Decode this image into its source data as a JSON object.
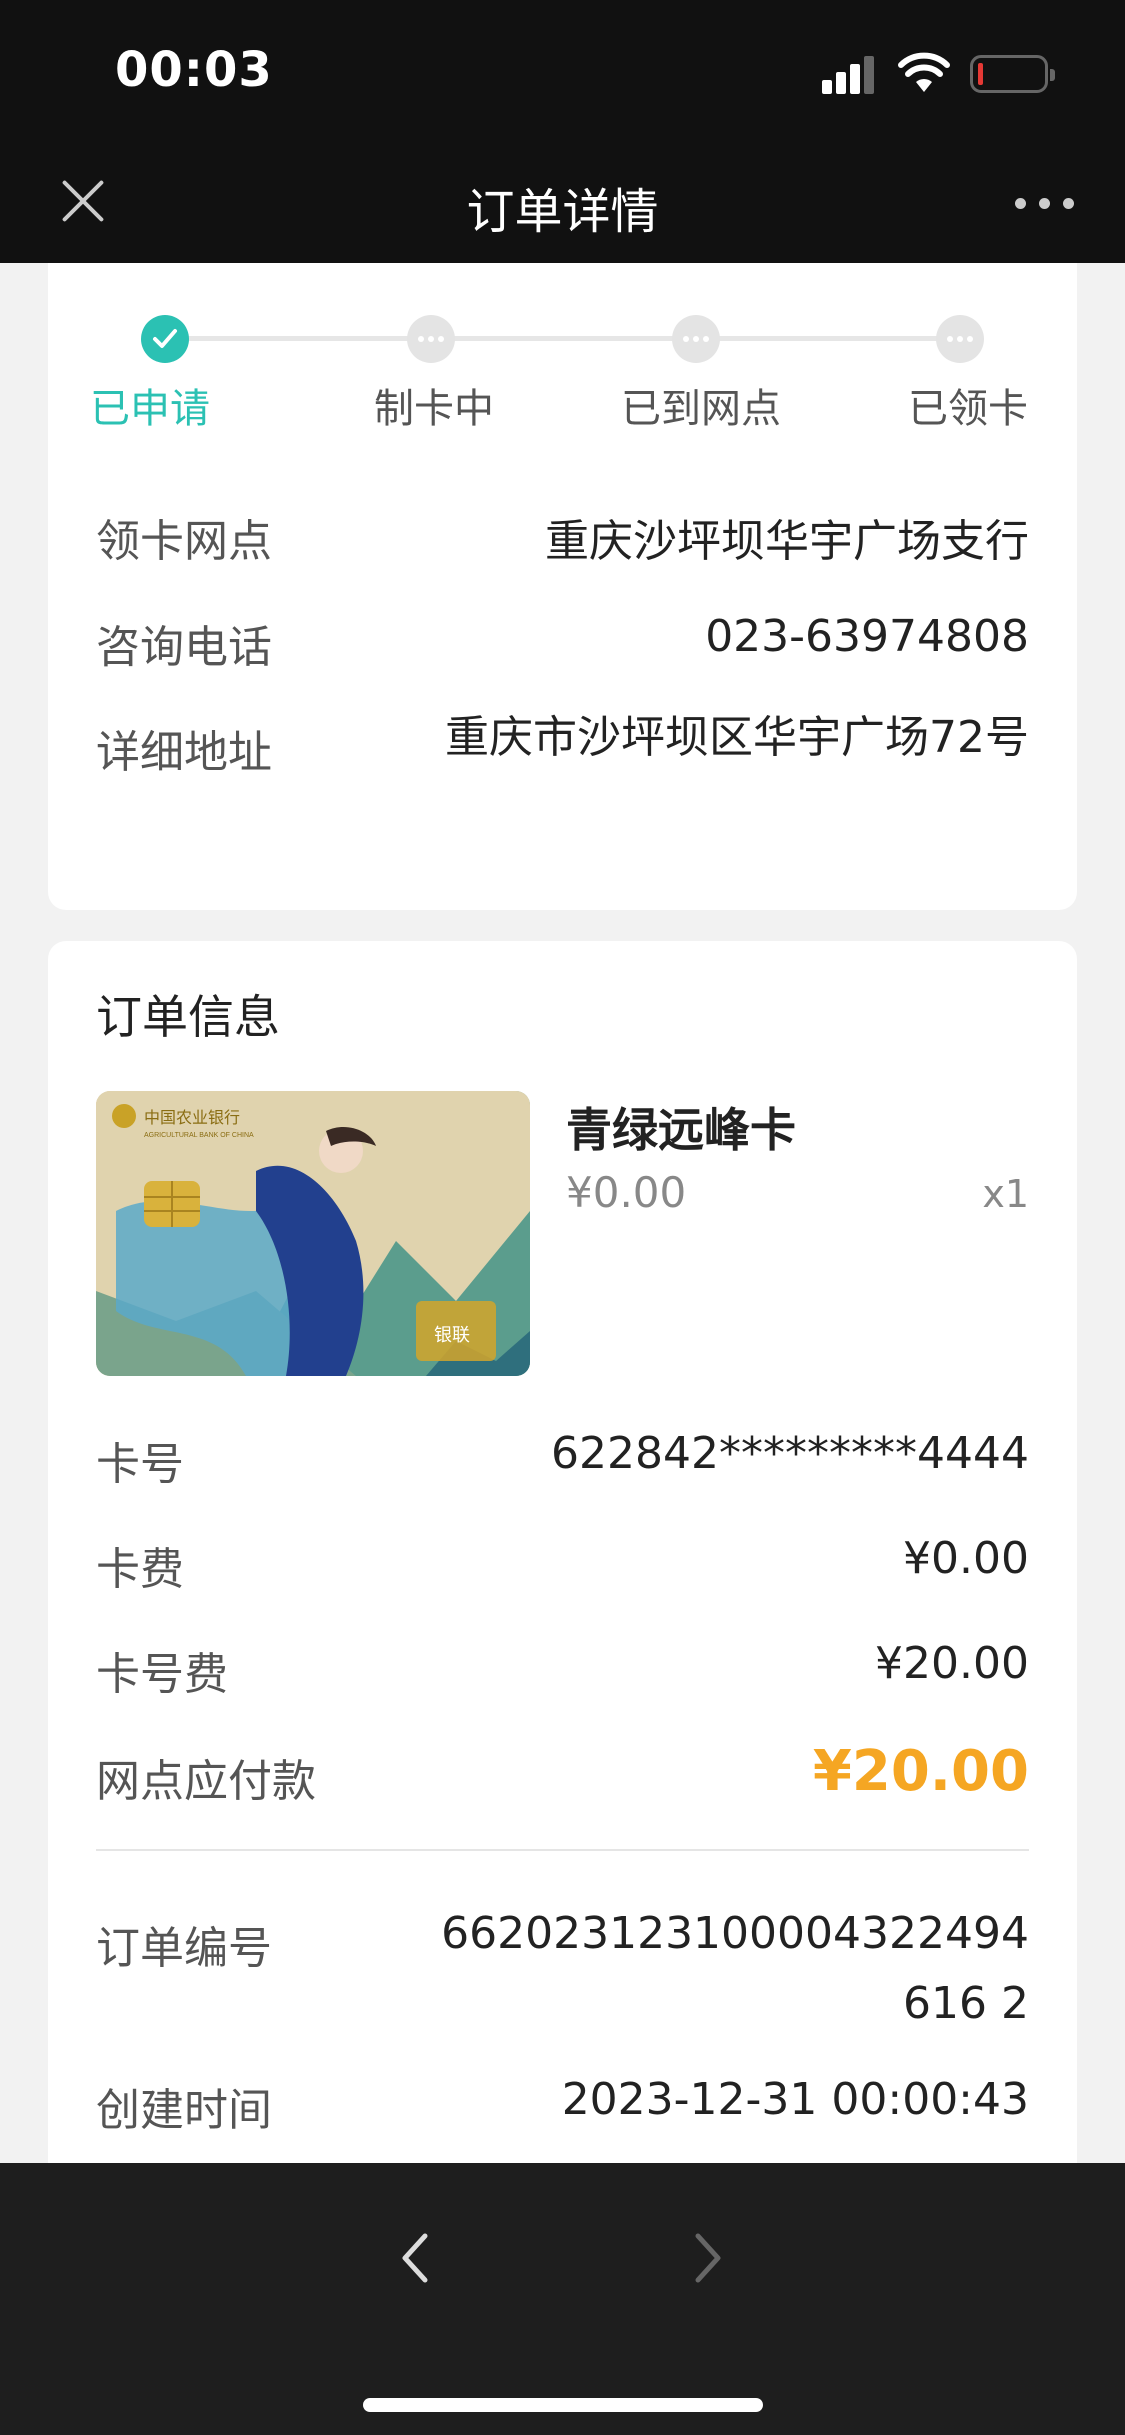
{
  "status_bar": {
    "time": "00:03"
  },
  "nav": {
    "title": "订单详情"
  },
  "steps": [
    {
      "label": "已申请",
      "state": "done"
    },
    {
      "label": "制卡中",
      "state": "pending"
    },
    {
      "label": "已到网点",
      "state": "pending"
    },
    {
      "label": "已领卡",
      "state": "pending"
    }
  ],
  "branch": {
    "branch_label": "领卡网点",
    "branch_value": "重庆沙坪坝华宇广场支行",
    "phone_label": "咨询电话",
    "phone_value": "023-63974808",
    "address_label": "详细地址",
    "address_value": "重庆市沙坪坝区华宇广场72号"
  },
  "order": {
    "section_title": "订单信息",
    "product": {
      "name": "青绿远峰卡",
      "price": "¥0.00",
      "qty": "x1",
      "image_bank_name": "中国农业银行",
      "image_bank_name_en": "AGRICULTURAL BANK OF CHINA",
      "image_network": "银联"
    },
    "card_no_label": "卡号",
    "card_no_value": "622842*********4444",
    "card_fee_label": "卡费",
    "card_fee_value": "¥0.00",
    "number_fee_label": "卡号费",
    "number_fee_value": "¥20.00",
    "pay_label": "网点应付款",
    "pay_value": "¥20.00",
    "order_no_label": "订单编号",
    "order_no_value": "662023123100004322494616 2",
    "created_label": "创建时间",
    "created_value": "2023-12-31 00:00:43"
  },
  "colors": {
    "accent": "#2bc1b3",
    "amount": "#f5a623"
  }
}
